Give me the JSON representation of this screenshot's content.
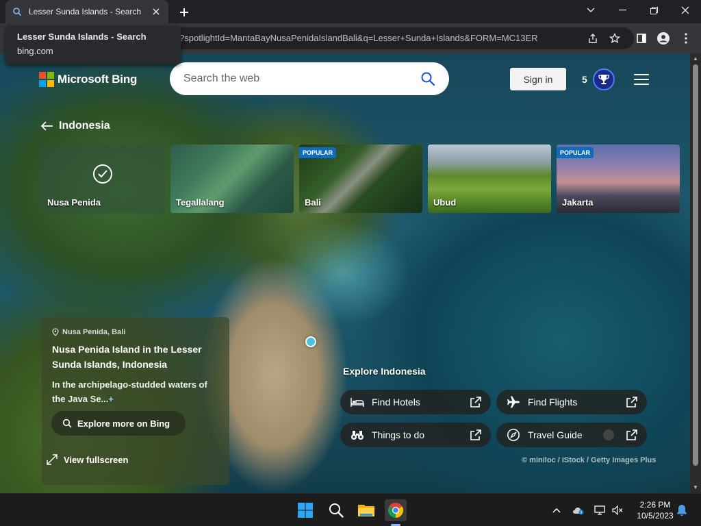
{
  "browser": {
    "tab_title": "Lesser Sunda Islands - Search",
    "url": "?spotlightId=MantaBayNusaPenidaIslandBali&q=Lesser+Sunda+Islands&FORM=MC13ER",
    "tooltip_title": "Lesser Sunda Islands - Search",
    "tooltip_domain": "bing.com"
  },
  "header": {
    "logo_text": "Microsoft Bing",
    "search_placeholder": "Search the web",
    "signin_label": "Sign in",
    "points": "5"
  },
  "region": {
    "back_label": "Indonesia"
  },
  "cards": [
    {
      "name": "Nusa Penida",
      "badge": "",
      "selected": true
    },
    {
      "name": "Tegallalang",
      "badge": "",
      "selected": false
    },
    {
      "name": "Bali",
      "badge": "POPULAR",
      "selected": false
    },
    {
      "name": "Ubud",
      "badge": "",
      "selected": false
    },
    {
      "name": "Jakarta",
      "badge": "POPULAR",
      "selected": false
    }
  ],
  "info": {
    "location": "Nusa Penida, Bali",
    "headline": "Nusa Penida Island in the Lesser Sunda Islands, Indonesia",
    "description": "In the archipelago-studded waters of the Java Se...",
    "explore_label": "Explore more on Bing",
    "fullscreen_label": "View fullscreen"
  },
  "explore": {
    "title": "Explore Indonesia",
    "hotels": "Find Hotels",
    "flights": "Find Flights",
    "things": "Things to do",
    "guide": "Travel Guide"
  },
  "credit": "© miniloc / iStock / Getty Images Plus",
  "taskbar": {
    "time": "2:26 PM",
    "date": "10/5/2023"
  },
  "colors": {
    "bing_red": "#f25022",
    "bing_green": "#7fba00",
    "bing_blue": "#00a4ef",
    "bing_yellow": "#ffb900",
    "badge_blue": "#0f6cbd"
  }
}
